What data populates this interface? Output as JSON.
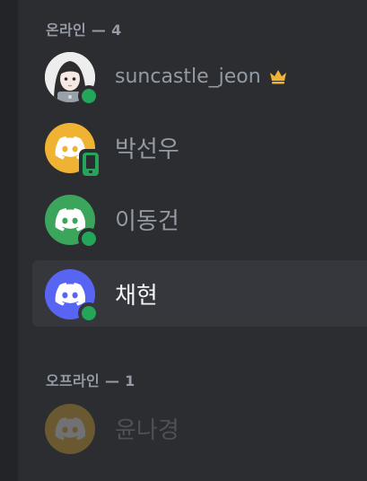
{
  "online_header": "온라인 — 4",
  "offline_header": "오프라인 — 1",
  "colors": {
    "background": "#2b2d31",
    "online": "#23a55a",
    "crown": "#f0b232",
    "active_row": "#35373c"
  },
  "members": [
    {
      "name": "suncastle_jeon",
      "status": "online",
      "owner": true,
      "avatar": "custom-portrait",
      "avatar_color": "#e8e8e8"
    },
    {
      "name": "박선우",
      "status": "online-mobile",
      "owner": false,
      "avatar": "discord-logo",
      "avatar_color": "#f0b232"
    },
    {
      "name": "이동건",
      "status": "online",
      "owner": false,
      "avatar": "discord-logo",
      "avatar_color": "#3ba55c"
    },
    {
      "name": "채현",
      "status": "online",
      "owner": false,
      "avatar": "discord-logo",
      "avatar_color": "#5865f2",
      "selected": true
    },
    {
      "name": "윤나경",
      "status": "offline",
      "owner": false,
      "avatar": "discord-logo",
      "avatar_color": "#f0b232"
    }
  ]
}
